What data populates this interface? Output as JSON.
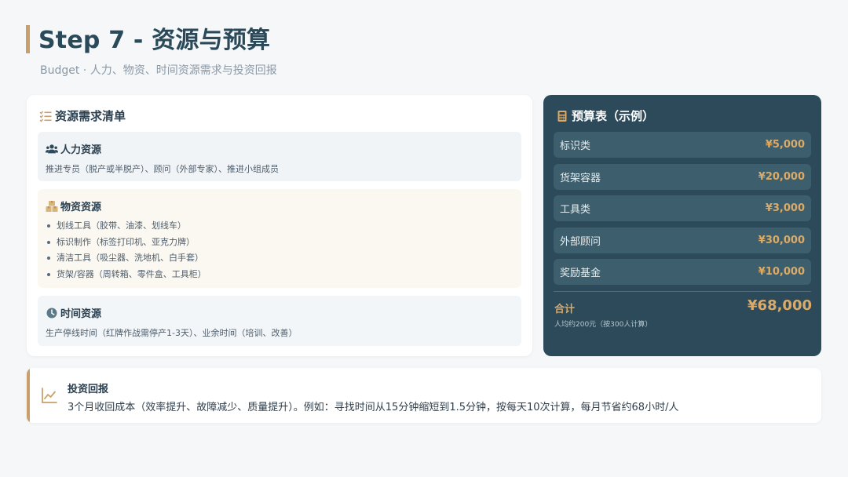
{
  "header": {
    "title": "Step 7 - 资源与预算",
    "subtitle": "Budget · 人力、物资、时间资源需求与投资回报"
  },
  "resources": {
    "heading": "资源需求清单",
    "human": {
      "title": "人力资源",
      "text": "推进专员（脱产或半脱产）、顾问（外部专家）、推进小组成员"
    },
    "material": {
      "title": "物资资源",
      "items": [
        "划线工具（胶带、油漆、划线车）",
        "标识制作（标签打印机、亚克力牌）",
        "清洁工具（吸尘器、洗地机、白手套）",
        "货架/容器（周转箱、零件盒、工具柜）"
      ]
    },
    "time": {
      "title": "时间资源",
      "text": "生产停线时间（红牌作战需停产1-3天）、业余时间（培训、改善）"
    }
  },
  "budget": {
    "heading": "预算表（示例）",
    "rows": [
      {
        "label": "标识类",
        "value": "¥5,000"
      },
      {
        "label": "货架容器",
        "value": "¥20,000"
      },
      {
        "label": "工具类",
        "value": "¥3,000"
      },
      {
        "label": "外部顾问",
        "value": "¥30,000"
      },
      {
        "label": "奖励基金",
        "value": "¥10,000"
      }
    ],
    "total_label": "合计",
    "total_value": "¥68,000",
    "note": "人均约200元（按300人计算）"
  },
  "roi": {
    "title": "投资回报",
    "text": "3个月收回成本（效率提升、故障减少、质量提升）。例如：寻找时间从15分钟缩短到1.5分钟，按每天10次计算，每月节省约68小时/人"
  },
  "colors": {
    "accent_gold": "#c9a06a",
    "dark_teal": "#2c4a5a",
    "value_gold": "#d9aa68"
  }
}
